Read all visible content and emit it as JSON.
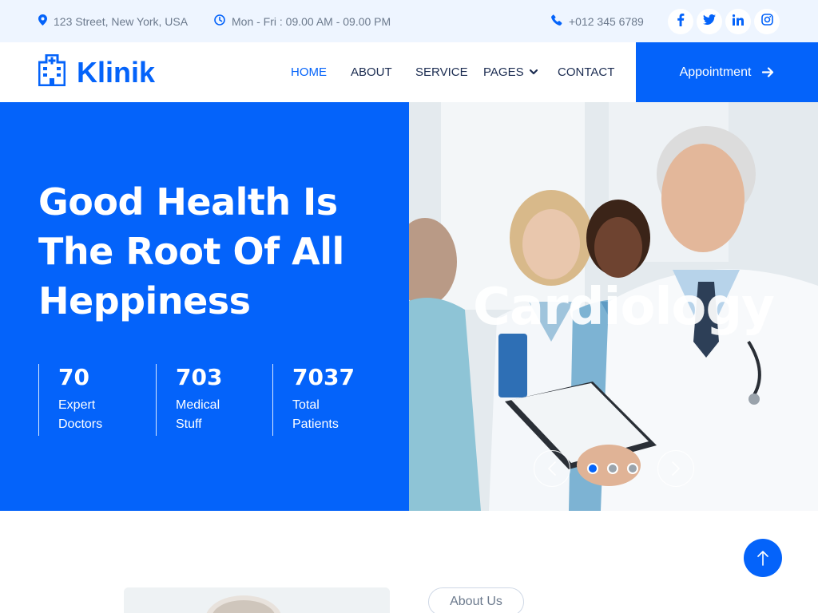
{
  "topbar": {
    "address": "123 Street, New York, USA",
    "hours": "Mon - Fri : 09.00 AM - 09.00 PM",
    "phone": "+012 345 6789",
    "socials": [
      "facebook-icon",
      "twitter-icon",
      "linkedin-icon",
      "instagram-icon"
    ]
  },
  "nav": {
    "brand": "Klinik",
    "links": [
      "HOME",
      "ABOUT",
      "SERVICE",
      "PAGES",
      "CONTACT"
    ],
    "active": "HOME",
    "appointment": "Appointment"
  },
  "hero": {
    "title_lines": [
      "Good Health Is",
      "The Root Of All",
      "Heppiness"
    ],
    "stats": [
      {
        "value": "70",
        "label": "Expert Doctors"
      },
      {
        "value": "703",
        "label": "Medical Stuff"
      },
      {
        "value": "7037",
        "label": "Total Patients"
      }
    ],
    "slide_caption": "Cardiology",
    "slide_count": 3,
    "active_slide": 1
  },
  "about": {
    "badge": "About Us"
  },
  "colors": {
    "primary": "#0463fa",
    "dark": "#1b2c51",
    "light_bg": "#eef5ff",
    "muted": "#6c7a8d"
  }
}
